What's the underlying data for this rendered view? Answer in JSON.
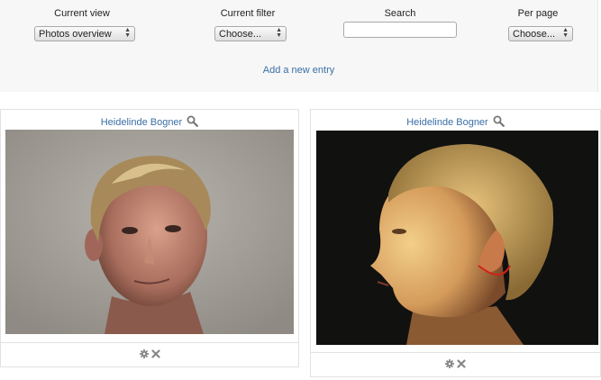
{
  "toolbar": {
    "current_view": {
      "label": "Current view",
      "value": "Photos overview"
    },
    "current_filter": {
      "label": "Current filter",
      "value": "Choose..."
    },
    "search": {
      "label": "Search",
      "value": "",
      "placeholder": ""
    },
    "per_page": {
      "label": "Per page",
      "value": "Choose..."
    },
    "add_entry_label": "Add a new entry"
  },
  "cards": [
    {
      "title": "Heidelinde Bogner",
      "zoom_icon": "search-icon",
      "actions": [
        "gear-icon",
        "close-icon"
      ]
    },
    {
      "title": "Heidelinde Bogner",
      "zoom_icon": "search-icon",
      "actions": [
        "gear-icon",
        "close-icon"
      ]
    }
  ],
  "colors": {
    "link": "#3a6ea5",
    "toolbar_bg": "#f7f7f7",
    "border": "#e2e2e2"
  }
}
